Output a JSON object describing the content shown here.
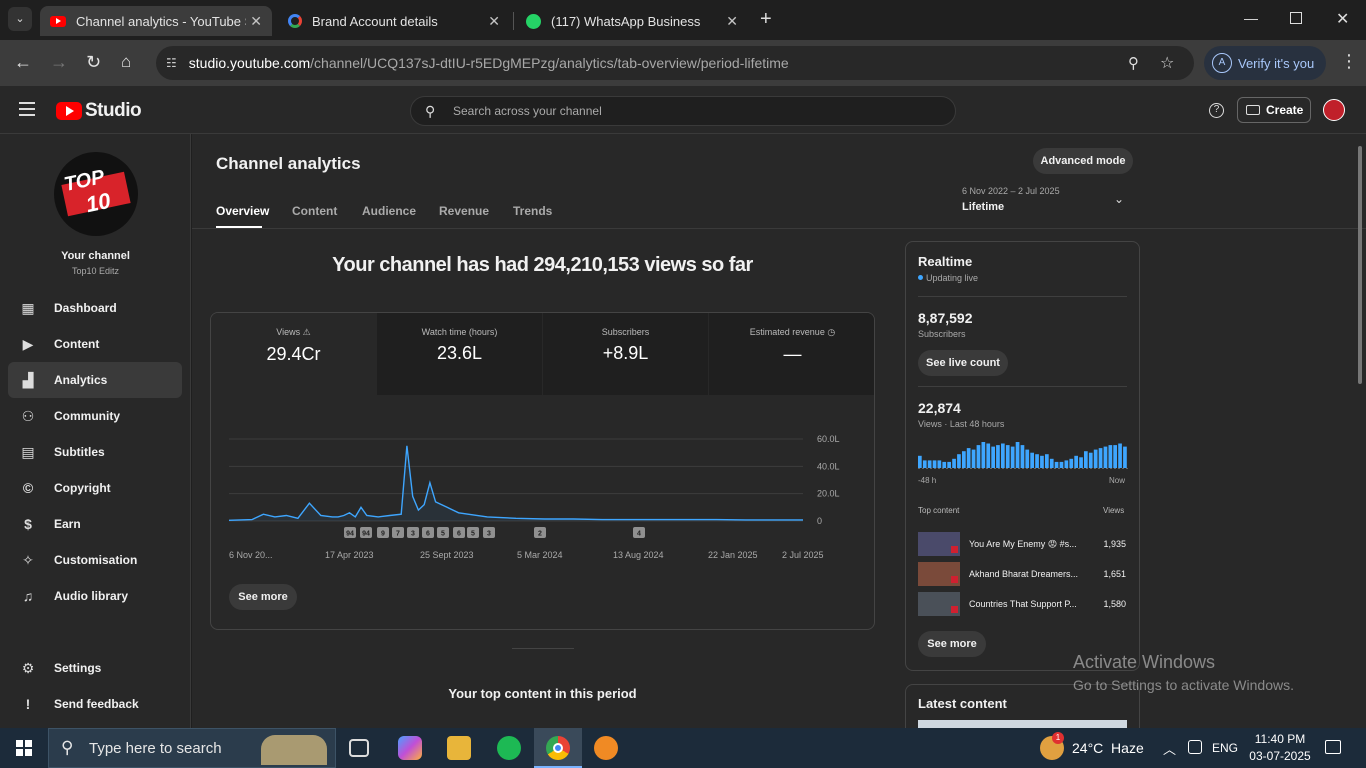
{
  "browser": {
    "tabs": [
      {
        "title": "Channel analytics - YouTube Stu",
        "active": true
      },
      {
        "title": "Brand Account details",
        "active": false
      },
      {
        "title": "(117) WhatsApp Business",
        "active": false
      }
    ],
    "url_host": "studio.youtube.com",
    "url_path": "/channel/UCQ137sJ-dtIU-r5EDgMEPzg/analytics/tab-overview/period-lifetime",
    "verify_label": "Verify it's you",
    "profile_initial": "A"
  },
  "header": {
    "brand": "Studio",
    "search_placeholder": "Search across your channel",
    "create_label": "Create"
  },
  "sidebar": {
    "channel_title": "Your channel",
    "channel_name": "Top10 Editz",
    "avatar_text_top": "TOP",
    "avatar_text_bottom": "10",
    "items": [
      {
        "label": "Dashboard"
      },
      {
        "label": "Content"
      },
      {
        "label": "Analytics"
      },
      {
        "label": "Community"
      },
      {
        "label": "Subtitles"
      },
      {
        "label": "Copyright"
      },
      {
        "label": "Earn"
      },
      {
        "label": "Customisation"
      },
      {
        "label": "Audio library"
      }
    ],
    "settings_label": "Settings",
    "feedback_label": "Send feedback"
  },
  "main": {
    "title": "Channel analytics",
    "advanced_mode": "Advanced mode",
    "tabs": [
      "Overview",
      "Content",
      "Audience",
      "Revenue",
      "Trends"
    ],
    "period_range": "6 Nov 2022 – 2 Jul 2025",
    "period_label": "Lifetime",
    "headline": "Your channel has had 294,210,153 views so far",
    "metrics": [
      {
        "label": "Views",
        "value": "29.4Cr"
      },
      {
        "label": "Watch time (hours)",
        "value": "23.6L"
      },
      {
        "label": "Subscribers",
        "value": "+8.9L"
      },
      {
        "label": "Estimated revenue",
        "value": "—"
      }
    ],
    "see_more": "See more",
    "top_content_heading": "Your top content in this period"
  },
  "chart_data": {
    "type": "line",
    "title": "",
    "ylabel": "",
    "ylim": [
      0,
      60
    ],
    "y_ticks": [
      "60.0L",
      "40.0L",
      "20.0L",
      "0"
    ],
    "x_tick_labels": [
      "6 Nov 20...",
      "17 Apr 2023",
      "25 Sept 2023",
      "5 Mar 2024",
      "13 Aug 2024",
      "22 Jan 2025",
      "2 Jul 2025"
    ],
    "series": [
      {
        "color": "#3ea6ff",
        "x": [
          0,
          4,
          6,
          8,
          10,
          12,
          14,
          16,
          18,
          19,
          20,
          21,
          22,
          23,
          24,
          26,
          28,
          30,
          31,
          32,
          33,
          34,
          35,
          36,
          38,
          40,
          45,
          50,
          55,
          60,
          65,
          70,
          75,
          80,
          85,
          90,
          95,
          100
        ],
        "values": [
          0.5,
          1,
          5,
          3,
          4,
          2,
          13,
          4,
          3,
          3,
          4,
          6,
          3,
          10,
          4,
          3,
          4,
          5,
          55,
          18,
          8,
          12,
          28,
          14,
          10,
          6,
          3,
          2,
          1.5,
          1.5,
          1,
          1,
          1,
          1,
          1,
          0.8,
          0.8,
          0.8
        ]
      }
    ],
    "markers": [
      "94",
      "94",
      "9",
      "7",
      "3",
      "6",
      "5",
      "6",
      "5",
      "3",
      "2",
      "4"
    ]
  },
  "realtime": {
    "title": "Realtime",
    "status": "Updating live",
    "subscribers_value": "8,87,592",
    "subscribers_label": "Subscribers",
    "see_live_count": "See live count",
    "views_value": "22,874",
    "views_label": "Views · Last 48 hours",
    "start_label": "-48 h",
    "end_label": "Now",
    "bar_values": [
      8,
      5,
      5,
      5,
      5,
      4,
      4,
      6,
      9,
      11,
      13,
      12,
      15,
      17,
      16,
      14,
      15,
      16,
      15,
      14,
      17,
      15,
      12,
      10,
      9,
      8,
      9,
      6,
      4,
      4,
      5,
      6,
      8,
      7,
      11,
      10,
      12,
      13,
      14,
      15,
      15,
      16,
      14
    ],
    "top_content_label": "Top content",
    "views_col_label": "Views",
    "top_content": [
      {
        "title": "You Are My Enemy 😡 #s...",
        "views": "1,935"
      },
      {
        "title": "Akhand Bharat Dreamers...",
        "views": "1,651"
      },
      {
        "title": "Countries That Support P...",
        "views": "1,580"
      }
    ],
    "see_more": "See more",
    "latest_content": "Latest content"
  },
  "watermark": {
    "line1": "Activate Windows",
    "line2": "Go to Settings to activate Windows."
  },
  "taskbar": {
    "search_placeholder": "Type here to search",
    "weather": "24°C  Haze",
    "weather_badge": "1",
    "language": "ENG",
    "time": "11:40 PM",
    "date": "03-07-2025"
  },
  "colors": {
    "accent_blue": "#3ea6ff",
    "youtube_red": "#ff0000"
  }
}
